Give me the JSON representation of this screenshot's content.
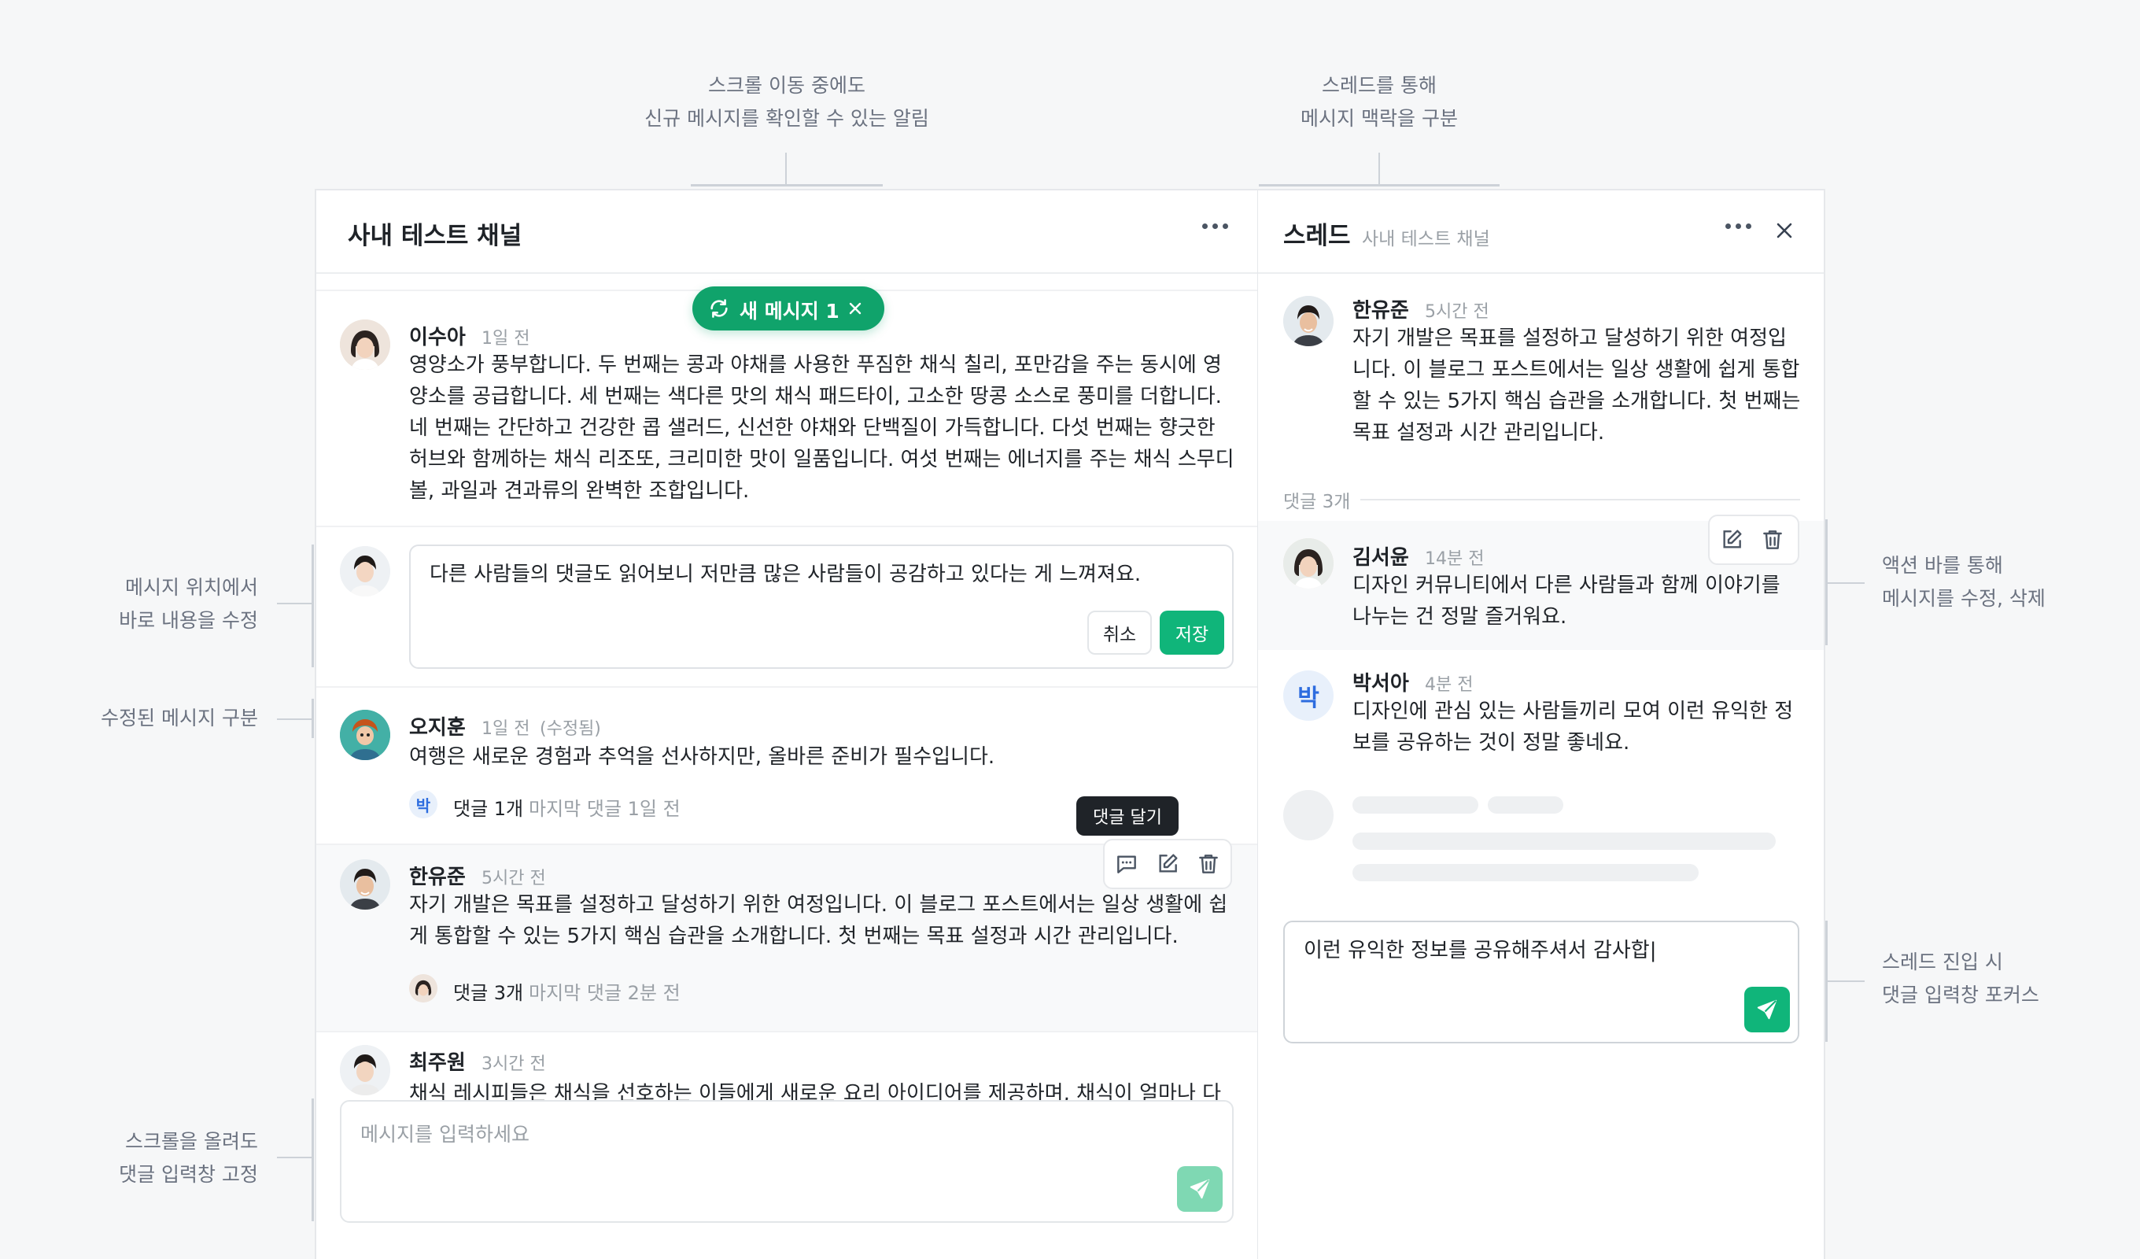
{
  "annotations": {
    "top_left": [
      "스크롤 이동 중에도",
      "신규 메시지를 확인할 수 있는 알림"
    ],
    "top_right": [
      "스레드를 통해",
      "메시지 맥락을 구분"
    ],
    "left_edit": [
      "메시지 위치에서",
      "바로 내용을 수정"
    ],
    "left_edited": "수정된 메시지 구분",
    "left_scroll": [
      "스크롤을 올려도",
      "댓글 입력창 고정"
    ],
    "right_action": [
      "액션 바를 통해",
      "메시지를 수정, 삭제"
    ],
    "right_focus": [
      "스레드 진입 시",
      "댓글 입력창 포커스"
    ]
  },
  "channel": {
    "title": "사내 테스트 채널",
    "new_message_pill": "새 메시지 1",
    "messages": [
      {
        "author": "이수아",
        "time": "1일 전",
        "lines": [
          "영양소가 풍부합니다. 두 번째는 콩과 야채를 사용한 푸짐한 채식 칠리, 포만감을 주는 동시에 영",
          "양소를 공급합니다. 세 번째는 색다른 맛의 채식 패드타이, 고소한 땅콩 소스로 풍미를 더합니다.",
          "네 번째는 간단하고 건강한 콥 샐러드, 신선한 야채와 단백질이 가득합니다. 다섯 번째는 향긋한",
          "허브와 함께하는 채식 리조또, 크리미한 맛이 일품입니다. 여섯 번째는 에너지를 주는 채식 스무디",
          "볼, 과일과 견과류의 완벽한 조합입니다."
        ]
      },
      {
        "editing_text": "다른 사람들의 댓글도 읽어보니 저만큼 많은 사람들이 공감하고 있다는 게 느껴져요.",
        "cancel_label": "취소",
        "save_label": "저장"
      },
      {
        "author": "오지훈",
        "time": "1일 전",
        "edited": "(수정됨)",
        "lines": [
          "여행은 새로운 경험과 추억을 선사하지만, 올바른 준비가 필수입니다."
        ],
        "thread_avatar": "박",
        "thread_count": "댓글 1개",
        "thread_last": "마지막 댓글 1일 전"
      },
      {
        "author": "한유준",
        "time": "5시간 전",
        "lines": [
          "자기 개발은 목표를 설정하고 달성하기 위한 여정입니다. 이 블로그 포스트에서는 일상 생활에 쉽",
          "게 통합할 수 있는 5가지 핵심 습관을 소개합니다. 첫 번째는 목표 설정과 시간 관리입니다."
        ],
        "thread_count": "댓글 3개",
        "thread_last": "마지막 댓글 2분 전",
        "tooltip": "댓글 달기"
      },
      {
        "author": "최주원",
        "time": "3시간 전",
        "lines": [
          "채식 레시피들은 채식을 선호하는 이들에게 새로운 요리 아이디어를 제공하며, 채식이 얼마나 다"
        ]
      }
    ],
    "composer_placeholder": "메시지를 입력하세요"
  },
  "thread": {
    "title": "스레드",
    "subtitle": "사내 테스트 채널",
    "root": {
      "author": "한유준",
      "time": "5시간 전",
      "lines": [
        "자기 개발은 목표를 설정하고 달성하기 위한 여정입",
        "니다. 이 블로그 포스트에서는 일상 생활에 쉽게 통합",
        "할 수 있는 5가지 핵심 습관을 소개합니다. 첫 번째는",
        "목표 설정과 시간 관리입니다."
      ]
    },
    "reply_count": "댓글 3개",
    "replies": [
      {
        "author": "김서윤",
        "time": "14분 전",
        "lines": [
          "디자인 커뮤니티에서 다른 사람들과 함께 이야기를",
          "나누는 건 정말 즐거워요."
        ]
      },
      {
        "author": "박서아",
        "time": "4분 전",
        "avatar_letter": "박",
        "lines": [
          "디자인에 관심 있는 사람들끼리 모여 이런 유익한 정",
          "보를 공유하는 것이 정말 좋네요."
        ]
      }
    ],
    "composer_value": "이런 유익한 정보를 공유해주셔서 감사합|"
  },
  "colors": {
    "accent": "#10a36b",
    "accent_light": "#7fd8b3",
    "annotation_text": "#6b7280",
    "muted": "#9aa0a6"
  }
}
